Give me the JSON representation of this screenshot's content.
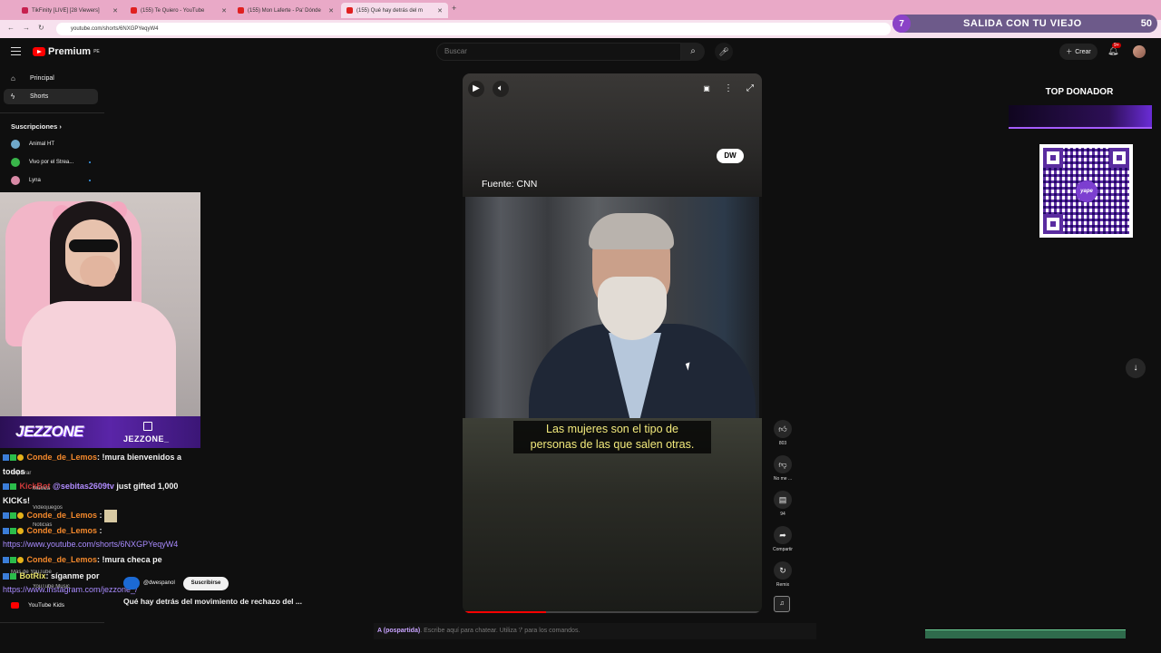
{
  "browser": {
    "tabs": [
      {
        "label": "TikFinity [LIVE] [28 Viewers]",
        "color": "#c7214f"
      },
      {
        "label": "(155) Te Quiero - YouTube",
        "color": "#e02020"
      },
      {
        "label": "(155) Mon Laferte - Pa' Dónde",
        "color": "#e02020"
      },
      {
        "label": "(155) Qué hay detrás del m",
        "color": "#e02020"
      }
    ],
    "new_tab": "+",
    "url": "youtube.com/shorts/6NXGPYeqyW4"
  },
  "overlay_banner": {
    "level": "7",
    "title": "SALIDA CON TU VIEJO",
    "count": "50"
  },
  "youtube": {
    "logo": "Premium",
    "logo_suffix": "PE",
    "search_placeholder": "Buscar",
    "create_label": "Crear",
    "notif_count": "9+",
    "sidebar": {
      "items": [
        {
          "label": "Principal",
          "icon": "home-icon"
        },
        {
          "label": "Shorts",
          "icon": "shorts-icon"
        }
      ],
      "subs_header": "Suscripciones",
      "subs": [
        {
          "label": "Animal HT",
          "color": "#6fa8c9"
        },
        {
          "label": "Vivo por el Strea...",
          "color": "#39b54a"
        },
        {
          "label": "Lyna",
          "color": "#d98aa6"
        }
      ],
      "bottom_item": "YouTube Kids"
    },
    "short": {
      "source": "Fuente: CNN",
      "logo": "DW",
      "subtitle_line1": "Las mujeres son el tipo de",
      "subtitle_line2": "personas de las que salen otras.",
      "channel": "@dwespanol",
      "subscribe": "Suscribirse",
      "title": "Qué hay detrás del movimiento de rechazo del ...",
      "progress": 0.28
    },
    "actions": [
      {
        "icon": "like-icon",
        "label": "803"
      },
      {
        "icon": "dislike-icon",
        "label": "No me ..."
      },
      {
        "icon": "comment-icon",
        "label": "94"
      },
      {
        "icon": "share-icon",
        "label": "Compartir"
      },
      {
        "icon": "remix-icon",
        "label": "Remix"
      }
    ]
  },
  "stream": {
    "channel_name": "JEZZONE_",
    "logo_text": "JEZZONE",
    "top_donor": "TOP DONADOR",
    "chat": [
      {
        "user": "Conde_de_Lemos",
        "text": ": !mura bienvenidos a todos"
      },
      {
        "user": "KickBot",
        "mention": "@sebitas2609tv",
        "text": " just gifted 1,000 KICKs!"
      },
      {
        "user": "Conde_de_Lemos",
        "text": " :"
      },
      {
        "user": "Conde_de_Lemos",
        "text": " :"
      },
      {
        "link": "https://www.youtube.com/shorts/6NXGPYeqyW4"
      },
      {
        "user": "Conde_de_Lemos",
        "text": ": !mura checa pe"
      },
      {
        "user": "BotRix",
        "text": ": síganme por"
      },
      {
        "link": "https://www.instagram.com/jezzone_/"
      }
    ],
    "ghost_labels": [
      "Explorar",
      "Música",
      "Videojuegos",
      "Noticias",
      "Más de YouTube",
      "YouTube Music"
    ],
    "chat_input_user": "A (pospartida)",
    "chat_input_placeholder": ". Escribe aquí para chatear. Utiliza '/' para los comandos."
  }
}
